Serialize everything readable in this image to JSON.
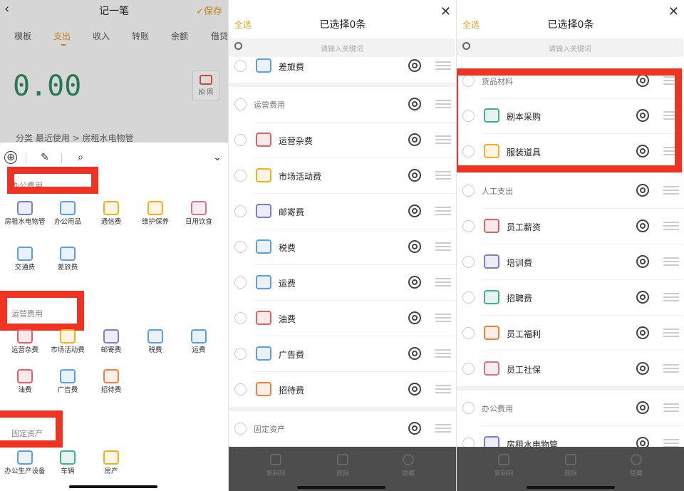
{
  "panel1": {
    "title": "记一笔",
    "back": "‹",
    "save": "✓保存",
    "tabs": [
      "模板",
      "支出",
      "收入",
      "转账",
      "余额",
      "借贷"
    ],
    "active_tab": "支出",
    "amount": "0.00",
    "camera_label": "拍 照",
    "breadcrumb": "分类  最近使用 > 房租水电物管",
    "toolbar": {
      "add": "⊕",
      "edit": "✎",
      "search": "⌕",
      "collapse": "⌄"
    },
    "sections": [
      {
        "label": "办公费用",
        "items": [
          {
            "label": "房租水电物管",
            "icon": "bus-icon",
            "color": "#7b7bd8"
          },
          {
            "label": "办公用品",
            "icon": "phone-icon",
            "color": "#5b9fe0"
          },
          {
            "label": "通信费",
            "icon": "mobile-icon",
            "color": "#f0b020"
          },
          {
            "label": "维护保养",
            "icon": "toolbox-icon",
            "color": "#f0b020"
          },
          {
            "label": "日用饮食",
            "icon": "book-icon",
            "color": "#e07090"
          },
          {
            "label": "交通费",
            "icon": "bus-icon",
            "color": "#5b9fe0"
          },
          {
            "label": "差旅费",
            "icon": "plane-icon",
            "color": "#5b9fe0"
          }
        ]
      },
      {
        "label": "运营费用",
        "items": [
          {
            "label": "运营杂费",
            "icon": "shop-icon",
            "color": "#e56060"
          },
          {
            "label": "市场活动费",
            "icon": "doc-icon",
            "color": "#f0b020"
          },
          {
            "label": "邮寄费",
            "icon": "mail-icon",
            "color": "#7b7bd8"
          },
          {
            "label": "税费",
            "icon": "shop-icon",
            "color": "#5b9fe0"
          },
          {
            "label": "运费",
            "icon": "card-icon",
            "color": "#5b9fe0"
          },
          {
            "label": "油费",
            "icon": "fuel-icon",
            "color": "#e56060"
          },
          {
            "label": "广告费",
            "icon": "phone-icon",
            "color": "#5b9fe0"
          },
          {
            "label": "招待费",
            "icon": "person-icon",
            "color": "#f08040"
          }
        ]
      },
      {
        "label": "固定资产",
        "items": [
          {
            "label": "办公生产设备",
            "icon": "device-icon",
            "color": "#5b9fe0"
          },
          {
            "label": "车辆",
            "icon": "bottle-icon",
            "color": "#40b090"
          },
          {
            "label": "房产",
            "icon": "house-icon",
            "color": "#f0b020"
          }
        ]
      }
    ]
  },
  "panel2": {
    "select_all": "全选",
    "title": "已选择0条",
    "close": "✕",
    "search_placeholder": "请输入关键词",
    "rows": [
      {
        "type": "item",
        "label": "差旅费",
        "icon": "plane-icon",
        "color": "#5b9fe0"
      },
      {
        "type": "header",
        "label": "运营费用"
      },
      {
        "type": "item",
        "label": "运营杂费",
        "icon": "shop-icon",
        "color": "#e56060"
      },
      {
        "type": "item",
        "label": "市场活动费",
        "icon": "doc-icon",
        "color": "#f0b020"
      },
      {
        "type": "item",
        "label": "邮寄费",
        "icon": "mail-icon",
        "color": "#7b7bd8"
      },
      {
        "type": "item",
        "label": "税费",
        "icon": "shop-icon",
        "color": "#5b9fe0"
      },
      {
        "type": "item",
        "label": "运费",
        "icon": "card-icon",
        "color": "#5b9fe0"
      },
      {
        "type": "item",
        "label": "油费",
        "icon": "fuel-icon",
        "color": "#e56060"
      },
      {
        "type": "item",
        "label": "广告费",
        "icon": "phone-icon",
        "color": "#5b9fe0"
      },
      {
        "type": "item",
        "label": "招待费",
        "icon": "person-icon",
        "color": "#f08040"
      },
      {
        "type": "header",
        "label": "固定资产"
      }
    ],
    "bottom_actions": [
      "复制到",
      "删除",
      "隐藏"
    ]
  },
  "panel3": {
    "select_all": "全选",
    "title": "已选择0条",
    "close": "✕",
    "search_placeholder": "请输入关键词",
    "rows": [
      {
        "type": "header",
        "label": "货品材料"
      },
      {
        "type": "item",
        "label": "剧本采购",
        "icon": "landscape-icon",
        "color": "#40b090"
      },
      {
        "type": "item",
        "label": "服装道具",
        "icon": "doc-icon",
        "color": "#f0b020"
      },
      {
        "type": "header",
        "label": "人工支出"
      },
      {
        "type": "item",
        "label": "员工薪资",
        "icon": "wallet-icon",
        "color": "#e56060"
      },
      {
        "type": "item",
        "label": "培训费",
        "icon": "books-icon",
        "color": "#7b7bd8"
      },
      {
        "type": "item",
        "label": "招聘费",
        "icon": "folder-icon",
        "color": "#40b090"
      },
      {
        "type": "item",
        "label": "员工福利",
        "icon": "gift-icon",
        "color": "#f08040"
      },
      {
        "type": "item",
        "label": "员工社保",
        "icon": "bag-icon",
        "color": "#e07090"
      },
      {
        "type": "header",
        "label": "办公费用"
      },
      {
        "type": "item",
        "label": "房租水电物管",
        "icon": "bus-icon",
        "color": "#7b7bd8"
      }
    ],
    "bottom_actions": [
      "复制到",
      "删除",
      "隐藏"
    ]
  },
  "colors": {
    "accent": "#d99a18",
    "highlight": "#ee3322",
    "amount": "#2d8a5f"
  }
}
